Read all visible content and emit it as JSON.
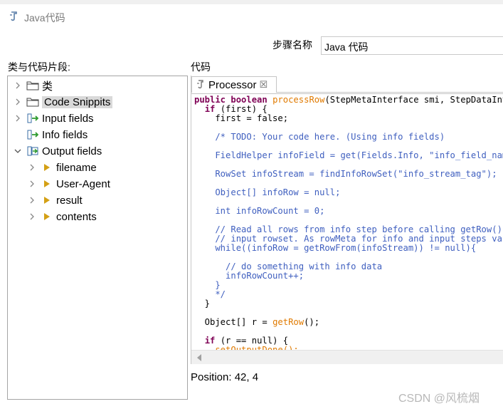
{
  "window": {
    "title": "Java代码"
  },
  "step": {
    "label": "步骤名称",
    "value": "Java 代码"
  },
  "left_panel": {
    "label": "类与代码片段:"
  },
  "tree": {
    "items": [
      {
        "label": "类",
        "icon": "folder-icon"
      },
      {
        "label": "Code Snippits",
        "icon": "folder-icon",
        "selected": true
      },
      {
        "label": "Input fields",
        "icon": "input-fields-icon"
      },
      {
        "label": "Info fields",
        "icon": "info-fields-icon"
      },
      {
        "label": "Output fields",
        "icon": "output-fields-icon",
        "expanded": true,
        "children": [
          {
            "label": "filename"
          },
          {
            "label": "User-Agent"
          },
          {
            "label": "result"
          },
          {
            "label": "contents"
          }
        ]
      }
    ]
  },
  "editor": {
    "label": "代码",
    "tab": {
      "label": "Processor",
      "icon": "java-file-icon",
      "close": "☒"
    },
    "lines": [
      "public boolean processRow(StepMetaInterface smi, StepDataInterface sdi) throws KettleException {",
      "  if (first) {",
      "    first = false;",
      "",
      "    /* TODO: Your code here. (Using info fields)",
      "",
      "    FieldHelper infoField = get(Fields.Info, \"info_field_name\");",
      "",
      "    RowSet infoStream = findInfoRowSet(\"info_stream_tag\");",
      "",
      "    Object[] infoRow = null;",
      "",
      "    int infoRowCount = 0;",
      "",
      "    // Read all rows from info step before calling getRow() from your",
      "    // input rowset. As rowMeta for info and input steps varies getRow()",
      "    while((infoRow = getRowFrom(infoStream)) != null){",
      "",
      "      // do something with info data",
      "      infoRowCount++;",
      "    }",
      "    */",
      "  }",
      "",
      "  Object[] r = getRow();",
      "",
      "  if (r == null) {",
      "    setOutputDone();"
    ]
  },
  "status": {
    "position": "Position: 42, 4"
  },
  "watermark": "CSDN @风梳烟"
}
